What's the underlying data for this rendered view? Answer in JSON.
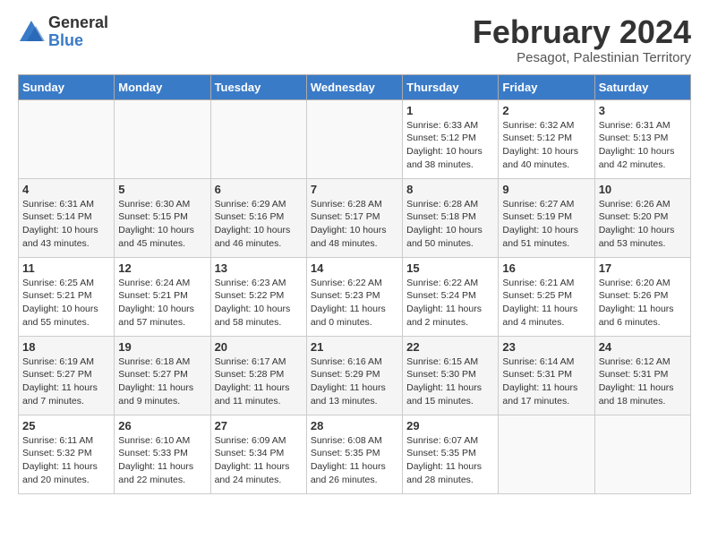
{
  "logo": {
    "general": "General",
    "blue": "Blue"
  },
  "title": "February 2024",
  "subtitle": "Pesagot, Palestinian Territory",
  "days_header": [
    "Sunday",
    "Monday",
    "Tuesday",
    "Wednesday",
    "Thursday",
    "Friday",
    "Saturday"
  ],
  "weeks": [
    [
      {
        "num": "",
        "info": ""
      },
      {
        "num": "",
        "info": ""
      },
      {
        "num": "",
        "info": ""
      },
      {
        "num": "",
        "info": ""
      },
      {
        "num": "1",
        "info": "Sunrise: 6:33 AM\nSunset: 5:12 PM\nDaylight: 10 hours\nand 38 minutes."
      },
      {
        "num": "2",
        "info": "Sunrise: 6:32 AM\nSunset: 5:12 PM\nDaylight: 10 hours\nand 40 minutes."
      },
      {
        "num": "3",
        "info": "Sunrise: 6:31 AM\nSunset: 5:13 PM\nDaylight: 10 hours\nand 42 minutes."
      }
    ],
    [
      {
        "num": "4",
        "info": "Sunrise: 6:31 AM\nSunset: 5:14 PM\nDaylight: 10 hours\nand 43 minutes."
      },
      {
        "num": "5",
        "info": "Sunrise: 6:30 AM\nSunset: 5:15 PM\nDaylight: 10 hours\nand 45 minutes."
      },
      {
        "num": "6",
        "info": "Sunrise: 6:29 AM\nSunset: 5:16 PM\nDaylight: 10 hours\nand 46 minutes."
      },
      {
        "num": "7",
        "info": "Sunrise: 6:28 AM\nSunset: 5:17 PM\nDaylight: 10 hours\nand 48 minutes."
      },
      {
        "num": "8",
        "info": "Sunrise: 6:28 AM\nSunset: 5:18 PM\nDaylight: 10 hours\nand 50 minutes."
      },
      {
        "num": "9",
        "info": "Sunrise: 6:27 AM\nSunset: 5:19 PM\nDaylight: 10 hours\nand 51 minutes."
      },
      {
        "num": "10",
        "info": "Sunrise: 6:26 AM\nSunset: 5:20 PM\nDaylight: 10 hours\nand 53 minutes."
      }
    ],
    [
      {
        "num": "11",
        "info": "Sunrise: 6:25 AM\nSunset: 5:21 PM\nDaylight: 10 hours\nand 55 minutes."
      },
      {
        "num": "12",
        "info": "Sunrise: 6:24 AM\nSunset: 5:21 PM\nDaylight: 10 hours\nand 57 minutes."
      },
      {
        "num": "13",
        "info": "Sunrise: 6:23 AM\nSunset: 5:22 PM\nDaylight: 10 hours\nand 58 minutes."
      },
      {
        "num": "14",
        "info": "Sunrise: 6:22 AM\nSunset: 5:23 PM\nDaylight: 11 hours\nand 0 minutes."
      },
      {
        "num": "15",
        "info": "Sunrise: 6:22 AM\nSunset: 5:24 PM\nDaylight: 11 hours\nand 2 minutes."
      },
      {
        "num": "16",
        "info": "Sunrise: 6:21 AM\nSunset: 5:25 PM\nDaylight: 11 hours\nand 4 minutes."
      },
      {
        "num": "17",
        "info": "Sunrise: 6:20 AM\nSunset: 5:26 PM\nDaylight: 11 hours\nand 6 minutes."
      }
    ],
    [
      {
        "num": "18",
        "info": "Sunrise: 6:19 AM\nSunset: 5:27 PM\nDaylight: 11 hours\nand 7 minutes."
      },
      {
        "num": "19",
        "info": "Sunrise: 6:18 AM\nSunset: 5:27 PM\nDaylight: 11 hours\nand 9 minutes."
      },
      {
        "num": "20",
        "info": "Sunrise: 6:17 AM\nSunset: 5:28 PM\nDaylight: 11 hours\nand 11 minutes."
      },
      {
        "num": "21",
        "info": "Sunrise: 6:16 AM\nSunset: 5:29 PM\nDaylight: 11 hours\nand 13 minutes."
      },
      {
        "num": "22",
        "info": "Sunrise: 6:15 AM\nSunset: 5:30 PM\nDaylight: 11 hours\nand 15 minutes."
      },
      {
        "num": "23",
        "info": "Sunrise: 6:14 AM\nSunset: 5:31 PM\nDaylight: 11 hours\nand 17 minutes."
      },
      {
        "num": "24",
        "info": "Sunrise: 6:12 AM\nSunset: 5:31 PM\nDaylight: 11 hours\nand 18 minutes."
      }
    ],
    [
      {
        "num": "25",
        "info": "Sunrise: 6:11 AM\nSunset: 5:32 PM\nDaylight: 11 hours\nand 20 minutes."
      },
      {
        "num": "26",
        "info": "Sunrise: 6:10 AM\nSunset: 5:33 PM\nDaylight: 11 hours\nand 22 minutes."
      },
      {
        "num": "27",
        "info": "Sunrise: 6:09 AM\nSunset: 5:34 PM\nDaylight: 11 hours\nand 24 minutes."
      },
      {
        "num": "28",
        "info": "Sunrise: 6:08 AM\nSunset: 5:35 PM\nDaylight: 11 hours\nand 26 minutes."
      },
      {
        "num": "29",
        "info": "Sunrise: 6:07 AM\nSunset: 5:35 PM\nDaylight: 11 hours\nand 28 minutes."
      },
      {
        "num": "",
        "info": ""
      },
      {
        "num": "",
        "info": ""
      }
    ]
  ]
}
